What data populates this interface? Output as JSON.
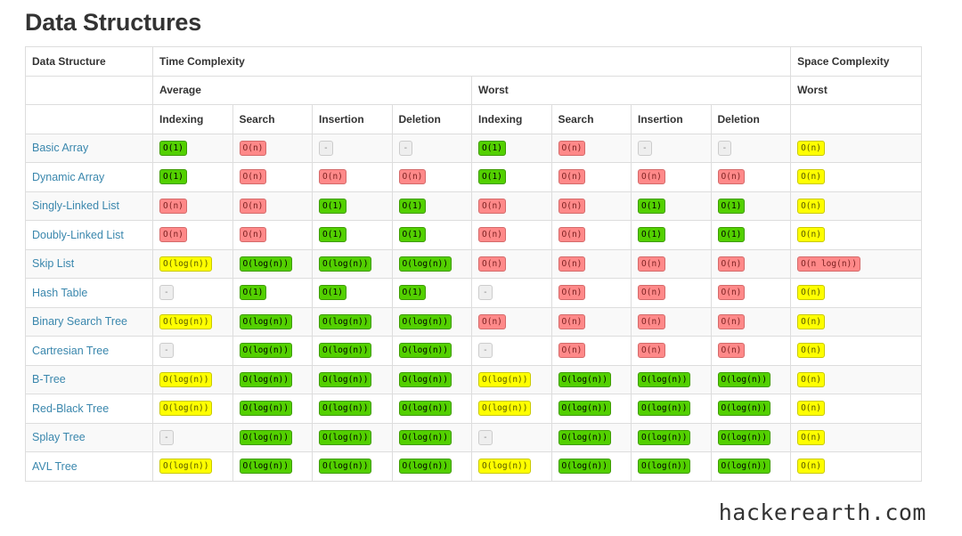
{
  "title": "Data Structures",
  "header": {
    "row1": {
      "data_structure": "Data Structure",
      "time_complexity": "Time Complexity",
      "space_complexity": "Space Complexity"
    },
    "row2": {
      "average": "Average",
      "worst": "Worst",
      "space_worst": "Worst"
    },
    "row3": [
      "Indexing",
      "Search",
      "Insertion",
      "Deletion",
      "Indexing",
      "Search",
      "Insertion",
      "Deletion"
    ]
  },
  "rating_colors": {
    "good": "#53d000",
    "fair": "#ffff00",
    "bad": "#ff8989",
    "none": "#eeeeee"
  },
  "rows": [
    {
      "name": "Basic Array",
      "cells": [
        {
          "text": "O(1)",
          "rating": "good"
        },
        {
          "text": "O(n)",
          "rating": "bad"
        },
        {
          "text": "-",
          "rating": "none"
        },
        {
          "text": "-",
          "rating": "none"
        },
        {
          "text": "O(1)",
          "rating": "good"
        },
        {
          "text": "O(n)",
          "rating": "bad"
        },
        {
          "text": "-",
          "rating": "none"
        },
        {
          "text": "-",
          "rating": "none"
        },
        {
          "text": "O(n)",
          "rating": "fair"
        }
      ]
    },
    {
      "name": "Dynamic Array",
      "cells": [
        {
          "text": "O(1)",
          "rating": "good"
        },
        {
          "text": "O(n)",
          "rating": "bad"
        },
        {
          "text": "O(n)",
          "rating": "bad"
        },
        {
          "text": "O(n)",
          "rating": "bad"
        },
        {
          "text": "O(1)",
          "rating": "good"
        },
        {
          "text": "O(n)",
          "rating": "bad"
        },
        {
          "text": "O(n)",
          "rating": "bad"
        },
        {
          "text": "O(n)",
          "rating": "bad"
        },
        {
          "text": "O(n)",
          "rating": "fair"
        }
      ]
    },
    {
      "name": "Singly-Linked List",
      "cells": [
        {
          "text": "O(n)",
          "rating": "bad"
        },
        {
          "text": "O(n)",
          "rating": "bad"
        },
        {
          "text": "O(1)",
          "rating": "good"
        },
        {
          "text": "O(1)",
          "rating": "good"
        },
        {
          "text": "O(n)",
          "rating": "bad"
        },
        {
          "text": "O(n)",
          "rating": "bad"
        },
        {
          "text": "O(1)",
          "rating": "good"
        },
        {
          "text": "O(1)",
          "rating": "good"
        },
        {
          "text": "O(n)",
          "rating": "fair"
        }
      ]
    },
    {
      "name": "Doubly-Linked List",
      "cells": [
        {
          "text": "O(n)",
          "rating": "bad"
        },
        {
          "text": "O(n)",
          "rating": "bad"
        },
        {
          "text": "O(1)",
          "rating": "good"
        },
        {
          "text": "O(1)",
          "rating": "good"
        },
        {
          "text": "O(n)",
          "rating": "bad"
        },
        {
          "text": "O(n)",
          "rating": "bad"
        },
        {
          "text": "O(1)",
          "rating": "good"
        },
        {
          "text": "O(1)",
          "rating": "good"
        },
        {
          "text": "O(n)",
          "rating": "fair"
        }
      ]
    },
    {
      "name": "Skip List",
      "cells": [
        {
          "text": "O(log(n))",
          "rating": "fair"
        },
        {
          "text": "O(log(n))",
          "rating": "good"
        },
        {
          "text": "O(log(n))",
          "rating": "good"
        },
        {
          "text": "O(log(n))",
          "rating": "good"
        },
        {
          "text": "O(n)",
          "rating": "bad"
        },
        {
          "text": "O(n)",
          "rating": "bad"
        },
        {
          "text": "O(n)",
          "rating": "bad"
        },
        {
          "text": "O(n)",
          "rating": "bad"
        },
        {
          "text": "O(n log(n))",
          "rating": "bad"
        }
      ]
    },
    {
      "name": "Hash Table",
      "cells": [
        {
          "text": "-",
          "rating": "none"
        },
        {
          "text": "O(1)",
          "rating": "good"
        },
        {
          "text": "O(1)",
          "rating": "good"
        },
        {
          "text": "O(1)",
          "rating": "good"
        },
        {
          "text": "-",
          "rating": "none"
        },
        {
          "text": "O(n)",
          "rating": "bad"
        },
        {
          "text": "O(n)",
          "rating": "bad"
        },
        {
          "text": "O(n)",
          "rating": "bad"
        },
        {
          "text": "O(n)",
          "rating": "fair"
        }
      ]
    },
    {
      "name": "Binary Search Tree",
      "cells": [
        {
          "text": "O(log(n))",
          "rating": "fair"
        },
        {
          "text": "O(log(n))",
          "rating": "good"
        },
        {
          "text": "O(log(n))",
          "rating": "good"
        },
        {
          "text": "O(log(n))",
          "rating": "good"
        },
        {
          "text": "O(n)",
          "rating": "bad"
        },
        {
          "text": "O(n)",
          "rating": "bad"
        },
        {
          "text": "O(n)",
          "rating": "bad"
        },
        {
          "text": "O(n)",
          "rating": "bad"
        },
        {
          "text": "O(n)",
          "rating": "fair"
        }
      ]
    },
    {
      "name": "Cartresian Tree",
      "cells": [
        {
          "text": "-",
          "rating": "none"
        },
        {
          "text": "O(log(n))",
          "rating": "good"
        },
        {
          "text": "O(log(n))",
          "rating": "good"
        },
        {
          "text": "O(log(n))",
          "rating": "good"
        },
        {
          "text": "-",
          "rating": "none"
        },
        {
          "text": "O(n)",
          "rating": "bad"
        },
        {
          "text": "O(n)",
          "rating": "bad"
        },
        {
          "text": "O(n)",
          "rating": "bad"
        },
        {
          "text": "O(n)",
          "rating": "fair"
        }
      ]
    },
    {
      "name": "B-Tree",
      "cells": [
        {
          "text": "O(log(n))",
          "rating": "fair"
        },
        {
          "text": "O(log(n))",
          "rating": "good"
        },
        {
          "text": "O(log(n))",
          "rating": "good"
        },
        {
          "text": "O(log(n))",
          "rating": "good"
        },
        {
          "text": "O(log(n))",
          "rating": "fair"
        },
        {
          "text": "O(log(n))",
          "rating": "good"
        },
        {
          "text": "O(log(n))",
          "rating": "good"
        },
        {
          "text": "O(log(n))",
          "rating": "good"
        },
        {
          "text": "O(n)",
          "rating": "fair"
        }
      ]
    },
    {
      "name": "Red-Black Tree",
      "cells": [
        {
          "text": "O(log(n))",
          "rating": "fair"
        },
        {
          "text": "O(log(n))",
          "rating": "good"
        },
        {
          "text": "O(log(n))",
          "rating": "good"
        },
        {
          "text": "O(log(n))",
          "rating": "good"
        },
        {
          "text": "O(log(n))",
          "rating": "fair"
        },
        {
          "text": "O(log(n))",
          "rating": "good"
        },
        {
          "text": "O(log(n))",
          "rating": "good"
        },
        {
          "text": "O(log(n))",
          "rating": "good"
        },
        {
          "text": "O(n)",
          "rating": "fair"
        }
      ]
    },
    {
      "name": "Splay Tree",
      "cells": [
        {
          "text": "-",
          "rating": "none"
        },
        {
          "text": "O(log(n))",
          "rating": "good"
        },
        {
          "text": "O(log(n))",
          "rating": "good"
        },
        {
          "text": "O(log(n))",
          "rating": "good"
        },
        {
          "text": "-",
          "rating": "none"
        },
        {
          "text": "O(log(n))",
          "rating": "good"
        },
        {
          "text": "O(log(n))",
          "rating": "good"
        },
        {
          "text": "O(log(n))",
          "rating": "good"
        },
        {
          "text": "O(n)",
          "rating": "fair"
        }
      ]
    },
    {
      "name": "AVL Tree",
      "cells": [
        {
          "text": "O(log(n))",
          "rating": "fair"
        },
        {
          "text": "O(log(n))",
          "rating": "good"
        },
        {
          "text": "O(log(n))",
          "rating": "good"
        },
        {
          "text": "O(log(n))",
          "rating": "good"
        },
        {
          "text": "O(log(n))",
          "rating": "fair"
        },
        {
          "text": "O(log(n))",
          "rating": "good"
        },
        {
          "text": "O(log(n))",
          "rating": "good"
        },
        {
          "text": "O(log(n))",
          "rating": "good"
        },
        {
          "text": "O(n)",
          "rating": "fair"
        }
      ]
    }
  ],
  "watermark": "hackerearth.com"
}
